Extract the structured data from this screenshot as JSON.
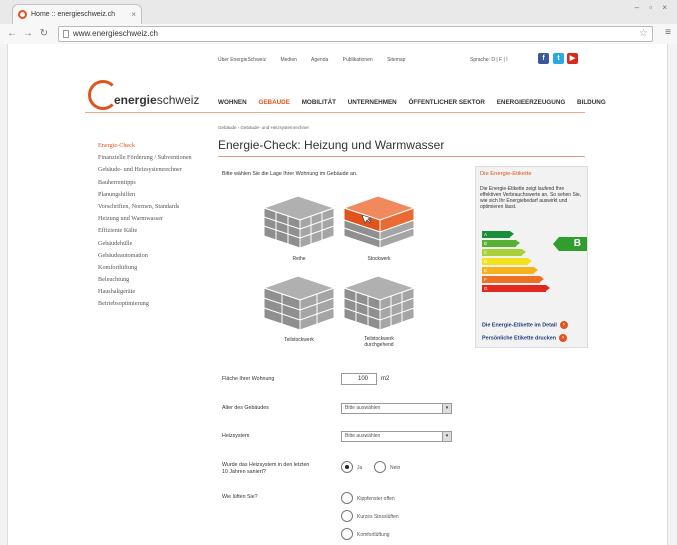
{
  "browser": {
    "tab_title": "Home :: energieschweiz.ch",
    "tab_close": "×",
    "window_controls": "– ▫ ×",
    "url": "www.energieschweiz.ch",
    "icons": [
      "back-icon",
      "forward-icon",
      "reload-icon",
      "page-icon",
      "star-icon",
      "menu-icon"
    ]
  },
  "topnav": {
    "items": [
      "Über EnergieSchweiz",
      "Medien",
      "Agenda",
      "Publikationen",
      "Sitemap"
    ],
    "language_label": "Sprache: D | F | I"
  },
  "social": {
    "facebook": "f",
    "twitter": "t",
    "youtube": "▶"
  },
  "logo": {
    "text_bold": "energie",
    "text_regular": "schweiz"
  },
  "mainnav": {
    "items": [
      "WOHNEN",
      "GEBÄUDE",
      "MOBILITÄT",
      "UNTERNEHMEN",
      "ÖFFENTLICHER SEKTOR",
      "ENERGIEERZEUGUNG",
      "BILDUNG"
    ],
    "active": "GEBÄUDE"
  },
  "breadcrumb": "Gebäude › Gebäude- und Heizsystemrechner",
  "sidebar": {
    "items": [
      "Energie-Check",
      "Finanzielle Förderung / Subventionen",
      "Gebäude- und Heizsystemrechner",
      "Bauherrentipps",
      "Planungshilfen",
      "Vorschriften, Normen, Standards",
      "Heizung und Warmwasser",
      "Effiziente Kälte",
      "Gebäudehülle",
      "Gebäudeautomation",
      "Komfortlüftung",
      "Beleuchtung",
      "Haushaltgeräte",
      "Betriebsoptimierung"
    ],
    "active": "Energie-Check"
  },
  "main": {
    "title": "Energie-Check: Heizung und Warmwasser",
    "intro": "Bitte wählen Sie die Lage Ihrer Wohnung im Gebäude an.",
    "buildings": {
      "reihe": "Reihe",
      "stockwerk": "Stockwerk",
      "teilstockwerk": "Teilstockwerk",
      "teilstockwerk_durch_1": "Teilstockwerk",
      "teilstockwerk_durch_2": "durchgehend"
    },
    "selected_building": "Stockwerk"
  },
  "etikette": {
    "title": "Die Energie-Etikette",
    "text": "Die Energie-Etikette zeigt laufend Ihre effektiven Verbrauchswerte an. So sehen Sie, wie sich Ihr Energiebedarf auswirkt und optimieren lässt.",
    "classes": [
      "A",
      "B",
      "C",
      "D",
      "E",
      "F",
      "G"
    ],
    "class_colors": [
      "#1a8f3a",
      "#56b135",
      "#a9cf3a",
      "#f2e21e",
      "#f6b21d",
      "#ec7123",
      "#e0281f"
    ],
    "current_class": "B",
    "link_1": "Die Energie-Etikette im Detail",
    "link_2": "Persönliche Etikette drucken",
    "link_icon": "›"
  },
  "form": {
    "flaeche_label": "Fläche Ihrer Wohnung",
    "flaeche_value": "100",
    "flaeche_unit": "m2",
    "alter_label": "Alter des Gebäudes",
    "alter_value": "Bitte auswählen",
    "heizsystem_label": "Heizsystem",
    "heizsystem_value": "Bitte auswählen",
    "saniert_label_1": "Wurde das Heizsystem in den letzten",
    "saniert_label_2": "10 Jahren saniert?",
    "saniert_ja": "Ja",
    "saniert_nein": "Nein",
    "saniert_selected": "Ja",
    "lueften_label": "Wie lüften Sie?",
    "lueften_options": [
      "Kippfenster offen",
      "Kurzes Stosslüften",
      "Komfortlüftung"
    ],
    "select_arrow": "▾"
  },
  "colors": {
    "accent": "#e1531c",
    "link": "#1f3d7a",
    "facebook": "#3b5998",
    "twitter": "#2aa9e0",
    "youtube": "#d62a1e"
  }
}
